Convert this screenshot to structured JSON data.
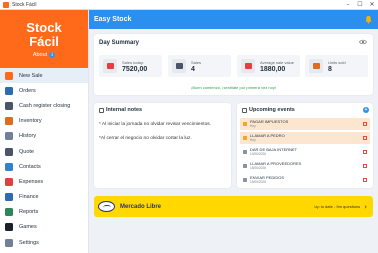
{
  "window": {
    "title": "Stock Fácil",
    "controls": [
      "–",
      "☐",
      "✕"
    ]
  },
  "brand": {
    "logo_line1": "Stock",
    "logo_line2": "Fácil",
    "about_label": "About",
    "about_icon": "i",
    "color": "#ff6a1a"
  },
  "sidebar": {
    "items": [
      {
        "label": "New Sale",
        "icon": "new-sale-icon",
        "color": "#ff6a1a",
        "active": true
      },
      {
        "label": "Orders",
        "icon": "orders-icon",
        "color": "#2b6cb0"
      },
      {
        "label": "Cash register closing",
        "icon": "cash-register-icon",
        "color": "#4a5568"
      },
      {
        "label": "Inventory",
        "icon": "inventory-icon",
        "color": "#dd6b20"
      },
      {
        "label": "History",
        "icon": "history-icon",
        "color": "#718096"
      },
      {
        "label": "Quote",
        "icon": "quote-icon",
        "color": "#4a5568"
      },
      {
        "label": "Contacts",
        "icon": "contacts-icon",
        "color": "#3182ce"
      },
      {
        "label": "Expenses",
        "icon": "expenses-icon",
        "color": "#e53e3e"
      },
      {
        "label": "Finance",
        "icon": "finance-icon",
        "color": "#2b6cb0"
      },
      {
        "label": "Reports",
        "icon": "reports-icon",
        "color": "#2f855a"
      },
      {
        "label": "Games",
        "icon": "games-icon",
        "color": "#1a202c"
      },
      {
        "label": "Settings",
        "icon": "settings-icon",
        "color": "#718096"
      }
    ]
  },
  "header": {
    "title": "Easy Stock",
    "accent": "#2b8ff0",
    "bell_color": "#f5b301"
  },
  "summary": {
    "title": "Day Summary",
    "kpis": [
      {
        "label": "Sales today:",
        "value": "7520,00",
        "icon": "cash-icon",
        "color": "#e53e3e"
      },
      {
        "label": "Sales",
        "value": "4",
        "icon": "receipt-icon",
        "color": "#4a5568"
      },
      {
        "label": "Average sale value",
        "value": "1880,00",
        "icon": "average-icon",
        "color": "#e53e3e"
      },
      {
        "label": "Units sold",
        "value": "8",
        "icon": "box-icon",
        "color": "#dd6b20"
      }
    ],
    "message": "¡Buen comienzo, ¡sentilate por primera vez hoy!",
    "message_color": "#2e9e4f"
  },
  "notes": {
    "title": "Internal notes",
    "lines": [
      "* Al iniciar la jornada no olvidar revisar vencimientos.",
      "*Al cerrar el negocio no olvidar cortar la luz."
    ]
  },
  "upcoming": {
    "title": "Upcoming events",
    "add_label": "+",
    "events": [
      {
        "title": "PAGAR IMPUESTOS",
        "date": "Hoy",
        "highlight": true
      },
      {
        "title": "LLAMAR A PEDRO",
        "date": "Hoy",
        "highlight": true
      },
      {
        "title": "DAR DE BAJA INTERNET",
        "date": "10/06/2026",
        "highlight": false
      },
      {
        "title": "LLAMAR A PROVEEDORES",
        "date": "15/06/2026",
        "highlight": false
      },
      {
        "title": "ENVIAR PEDIDOS",
        "date": "15/06/2026",
        "highlight": false
      }
    ]
  },
  "banner": {
    "title": "Mercado Libre",
    "status": "Up to date - 9m questions",
    "color": "#ffd800"
  }
}
